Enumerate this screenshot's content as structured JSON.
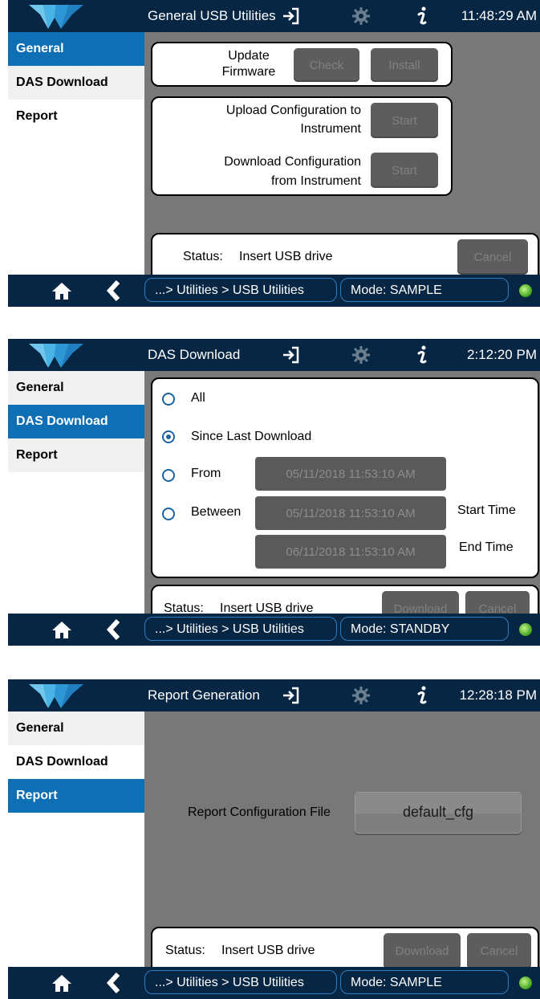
{
  "common": {
    "sidebar": [
      "General",
      "DAS Download",
      "Report"
    ],
    "breadcrumb": "...> Utilities > USB Utilities"
  },
  "screens": [
    {
      "title": "General USB Utilities",
      "time": "11:48:29 AM",
      "mode": "Mode: SAMPLE",
      "active_tab": "General",
      "firmware": {
        "label_line1": "Update",
        "label_line2": "Firmware",
        "check": "Check",
        "install": "Install"
      },
      "upload": {
        "line1": "Upload Configuration to",
        "line2": "Instrument",
        "button": "Start"
      },
      "download": {
        "line1": "Download Configuration",
        "line2": "from Instrument",
        "button": "Start"
      },
      "status": {
        "label": "Status:",
        "value": "Insert USB drive",
        "cancel": "Cancel"
      }
    },
    {
      "title": "DAS Download",
      "time": "2:12:20 PM",
      "mode": "Mode: STANDBY",
      "active_tab": "DAS Download",
      "options": [
        {
          "label": "All",
          "selected": false
        },
        {
          "label": "Since Last Download",
          "selected": true
        },
        {
          "label": "From",
          "selected": false
        },
        {
          "label": "Between",
          "selected": false
        }
      ],
      "from_date": "05/11/2018 11:53:10 AM",
      "between_start": "05/11/2018 11:53:10 AM",
      "between_end": "06/11/2018 11:53:10 AM",
      "start_time_label": "Start Time",
      "end_time_label": "End Time",
      "status": {
        "label": "Status:",
        "value": "Insert USB drive",
        "download": "Download",
        "cancel": "Cancel"
      }
    },
    {
      "title": "Report Generation",
      "time": "12:28:18 PM",
      "mode": "Mode: SAMPLE",
      "active_tab": "Report",
      "report_label": "Report Configuration File",
      "report_value": "default_cfg",
      "status": {
        "label": "Status:",
        "value": "Insert USB drive",
        "download": "Download",
        "cancel": "Cancel"
      }
    }
  ],
  "colors": {
    "topbar": "#072644",
    "active_tab": "#0e6fb4",
    "content_bg": "#787878",
    "led": "#3ea01a"
  },
  "icons": [
    "teledyne-logo-icon",
    "sign-in-icon",
    "gear-icon",
    "info-icon",
    "home-icon",
    "back-chevron-icon",
    "status-led-icon"
  ]
}
